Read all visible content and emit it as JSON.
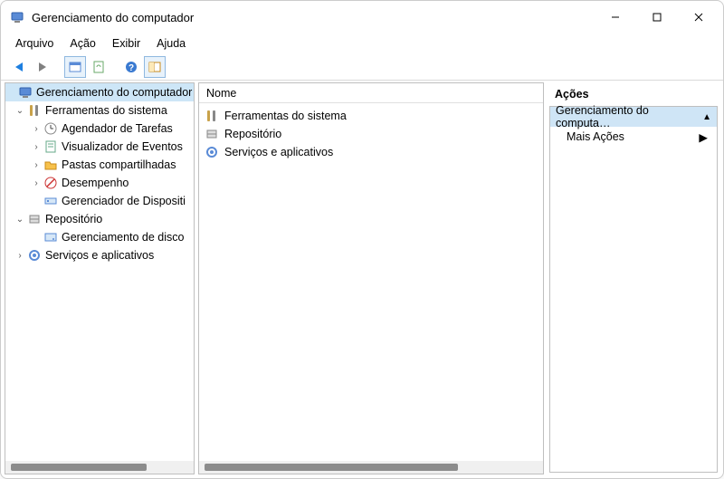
{
  "window": {
    "title": "Gerenciamento do computador"
  },
  "menu": {
    "arquivo": "Arquivo",
    "acao": "Ação",
    "exibir": "Exibir",
    "ajuda": "Ajuda"
  },
  "tree": {
    "root": "Gerenciamento do computador",
    "ferramentas": "Ferramentas do sistema",
    "agendador": "Agendador de Tarefas",
    "visualizador": "Visualizador de Eventos",
    "pastas": "Pastas compartilhadas",
    "desempenho": "Desempenho",
    "gerenciador_disp": "Gerenciador de Dispositi",
    "repositorio": "Repositório",
    "gerenc_disco": "Gerenciamento de disco",
    "servicos": "Serviços e aplicativos"
  },
  "list": {
    "header_nome": "Nome",
    "ferramentas": "Ferramentas do sistema",
    "repositorio": "Repositório",
    "servicos": "Serviços e aplicativos"
  },
  "actions": {
    "title": "Ações",
    "context": "Gerenciamento do computa…",
    "more": "Mais Ações"
  }
}
